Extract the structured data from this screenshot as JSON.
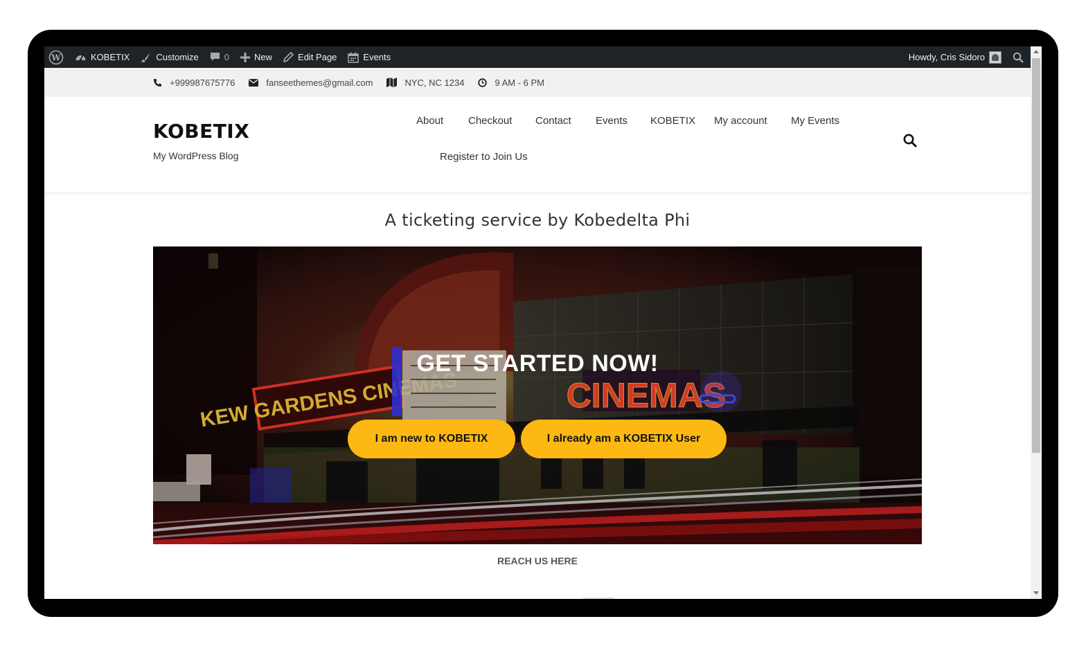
{
  "admin_bar": {
    "site_name": "KOBETIX",
    "customize": "Customize",
    "comments_count": "0",
    "new_label": "New",
    "edit_page": "Edit Page",
    "events": "Events",
    "howdy": "Howdy, Cris Sidoro"
  },
  "info_bar": {
    "phone": "+999987675776",
    "email": "fanseethemes@gmail.com",
    "location": "NYC, NC 1234",
    "hours": "9 AM - 6 PM"
  },
  "header": {
    "site_title": "KOBETIX",
    "tagline": "My WordPress Blog",
    "nav": [
      "About",
      "Checkout",
      "Contact",
      "Events",
      "KOBETIX",
      "My account",
      "My Events",
      "Register to Join Us"
    ]
  },
  "main": {
    "heading": "A ticketing service by Kobedelta Phi",
    "hero_title": "GET STARTED NOW!",
    "button_new": "I am new to KOBETIX",
    "button_existing": "I already am a KOBETIX User",
    "reach_us": "REACH US HERE",
    "sign_left": "KEW GARDENS CINEMAS",
    "sign_right": "CINEMAS"
  },
  "colors": {
    "admin_bg": "#1d2327",
    "info_bg": "#f1f1f1",
    "button": "#fdb813"
  }
}
